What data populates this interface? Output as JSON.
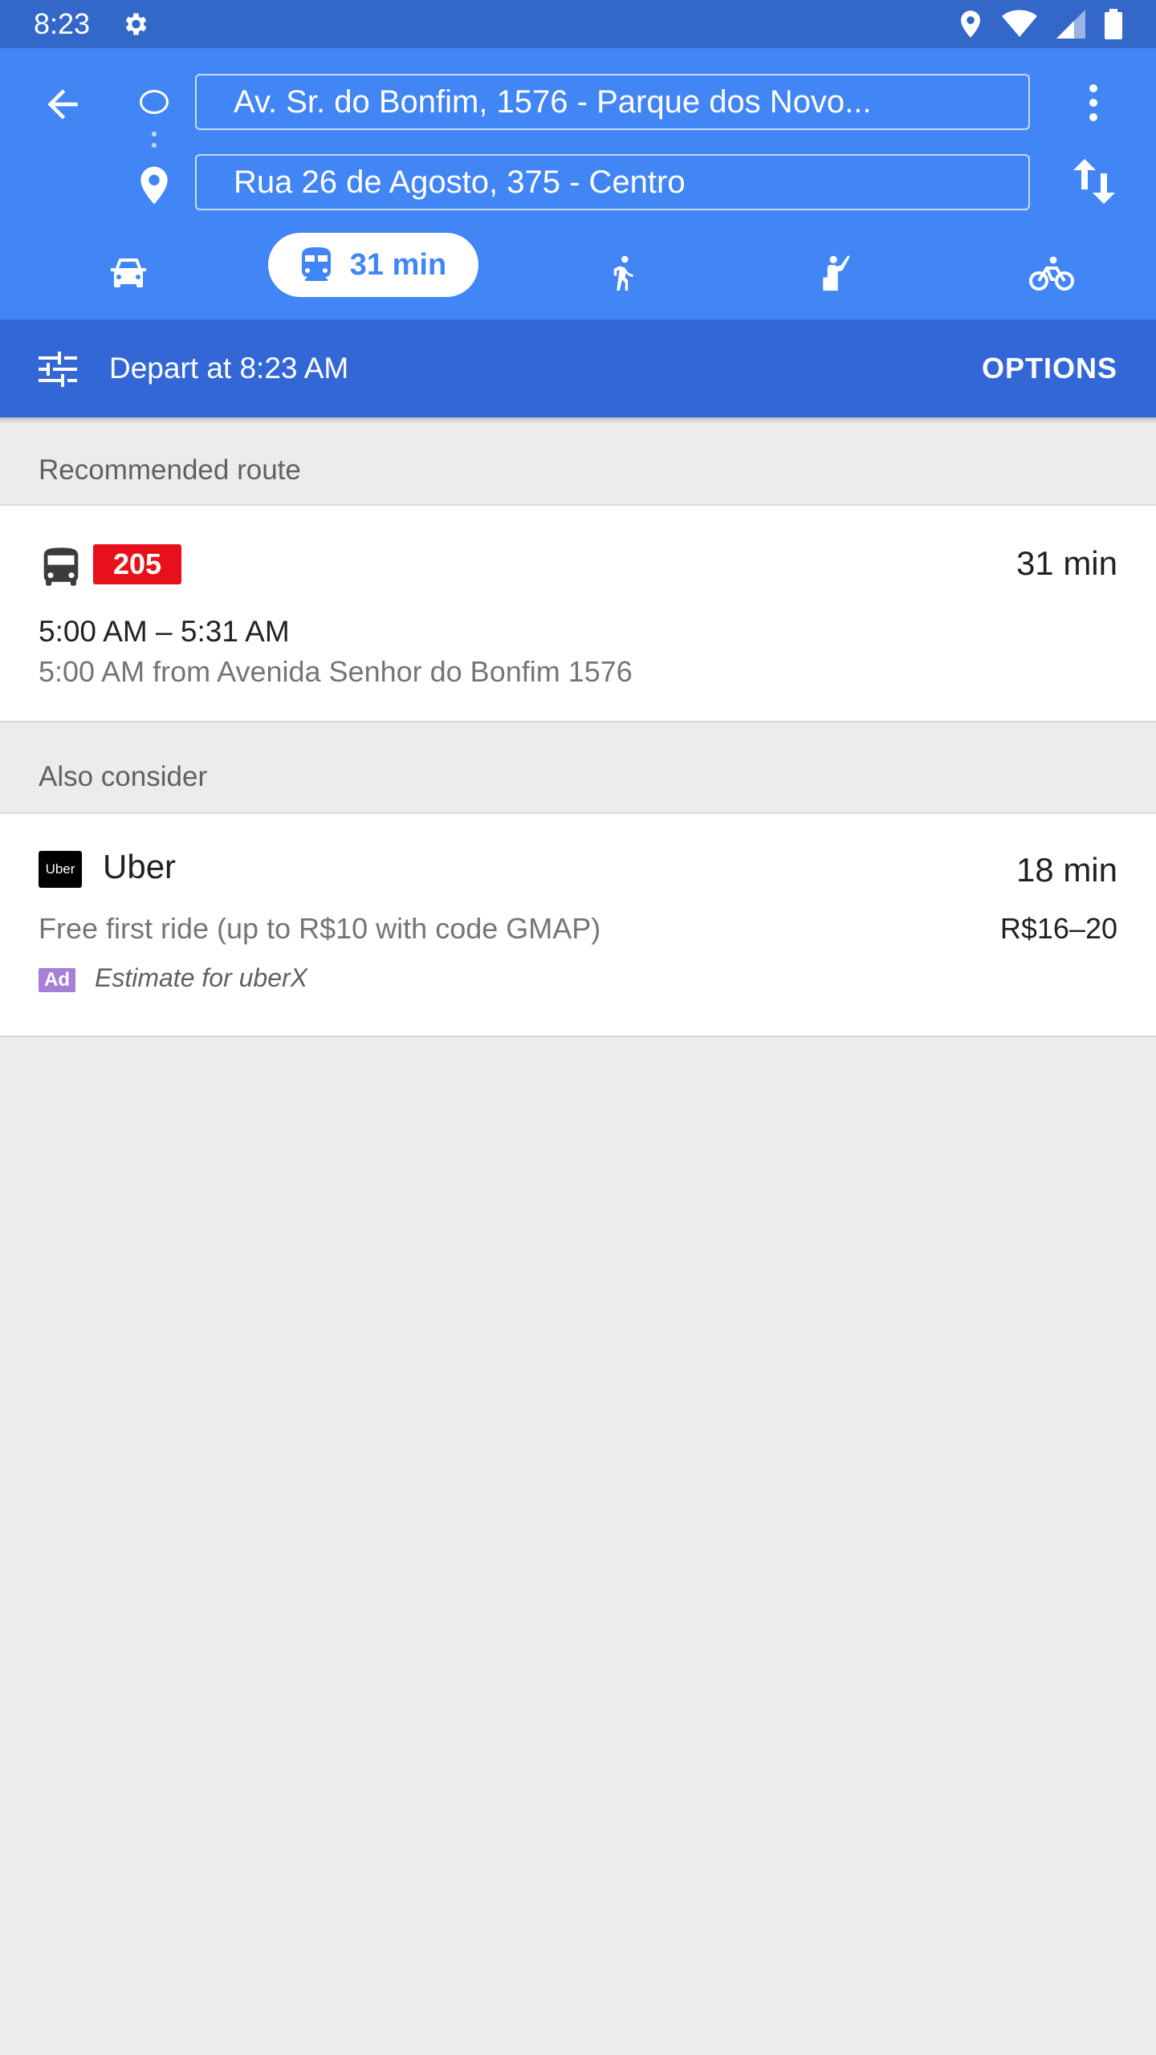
{
  "status_bar": {
    "time": "8:23"
  },
  "search": {
    "origin": "Av. Sr. do Bonfim, 1576 - Parque dos Novo...",
    "destination": "Rua 26 de Agosto, 375 - Centro"
  },
  "travel_modes": {
    "transit_label": "31 min"
  },
  "depart": {
    "label": "Depart at 8:23 AM",
    "options_label": "OPTIONS"
  },
  "recommended": {
    "section_title": "Recommended route",
    "line_number": "205",
    "duration": "31 min",
    "time_range": "5:00 AM – 5:31 AM",
    "departure_info": "5:00 AM from Avenida Senhor do Bonfim 1576"
  },
  "also_consider": {
    "section_title": "Also consider",
    "uber_logo_text": "Uber",
    "provider": "Uber",
    "duration": "18 min",
    "promo": "Free first ride (up to R$10 with code GMAP)",
    "price": "R$16–20",
    "ad_label": "Ad",
    "estimate": "Estimate for uberX"
  },
  "colors": {
    "header_blue": "#4285f4",
    "depart_bar": "#3367d6",
    "status_bar": "#3367c8",
    "route_badge": "#e8111b",
    "ad_badge": "#a67fd6"
  }
}
